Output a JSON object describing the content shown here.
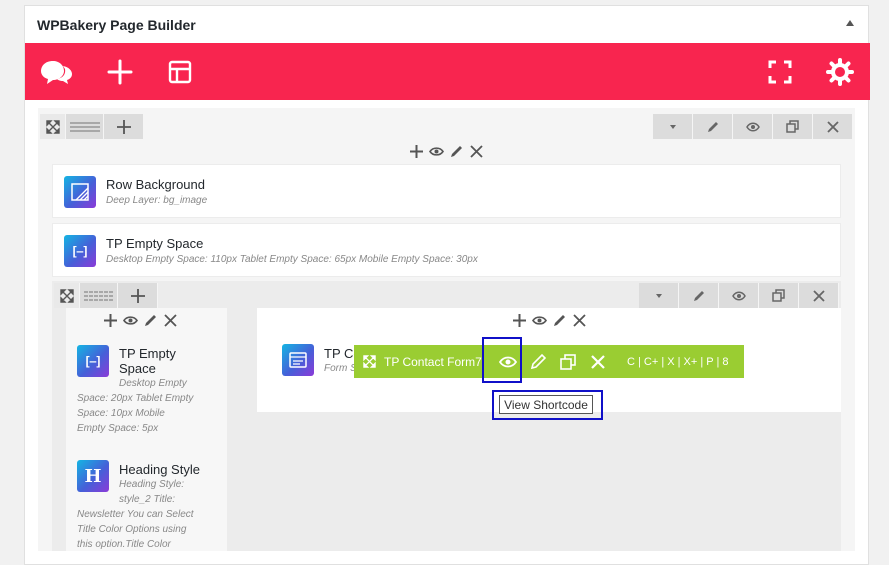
{
  "panel": {
    "title": "WPBakery Page Builder"
  },
  "toolbar": {
    "icons": [
      "logo-icon",
      "add-element-icon",
      "templates-icon",
      "fullscreen-icon",
      "settings-icon"
    ]
  },
  "elements": {
    "row_background": {
      "title": "Row Background",
      "sub": "Deep Layer: bg_image"
    },
    "tp_empty_space": {
      "title": "TP Empty Space",
      "sub": "Desktop Empty Space: 110px  Tablet Empty Space: 65px  Mobile Empty Space: 30px"
    },
    "col_empty_space": {
      "title_line1": "TP Empty",
      "title_line2": "Space",
      "sub_lines": [
        "Desktop Empty",
        "Space: 20px  Tablet Empty",
        "Space: 10px  Mobile",
        "Empty Space: 5px"
      ]
    },
    "heading_style": {
      "title": "Heading Style",
      "sub_lines": [
        "Heading Style:",
        "style_2  Title:",
        "Newsletter  You can Select",
        "Title Color Options using",
        "this option.Title Color"
      ]
    },
    "tp_contact": {
      "title": "TP Co",
      "sub": "Form S"
    }
  },
  "green_bar": {
    "label": "TP Contact Form7",
    "shortcut": "C | C+ | X | X+ | P | 8"
  },
  "tooltip": {
    "text": "View Shortcode"
  },
  "colors": {
    "toolbar": "#f8254f",
    "green_bar": "#9acd32",
    "highlight": "#1010c8"
  }
}
